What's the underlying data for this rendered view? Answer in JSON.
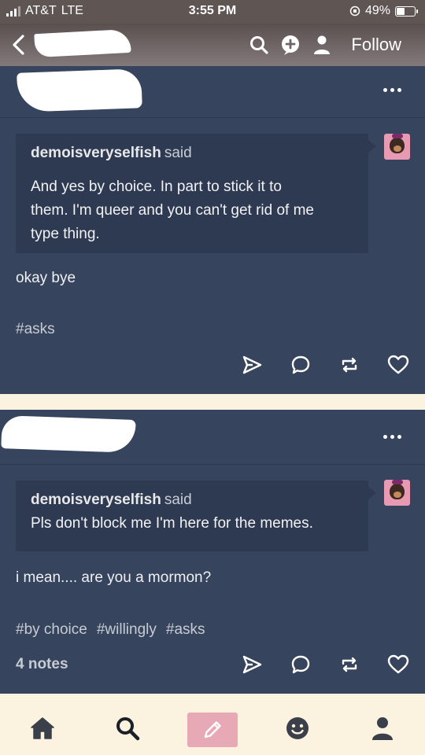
{
  "status_bar": {
    "carrier": "AT&T",
    "network": "LTE",
    "time": "3:55 PM",
    "battery": "49%",
    "battery_level": 0.49
  },
  "nav": {
    "follow_label": "Follow",
    "icons": [
      "back-chevron-icon",
      "search-icon",
      "add-circle-icon",
      "person-icon"
    ]
  },
  "posts": [
    {
      "quote_user": "demoisveryselfish",
      "quote_said": "said",
      "quote_lines": [
        "And yes by choice. In part to stick it to",
        "them. I'm queer and you can't get rid of me",
        "type thing."
      ],
      "reply": "okay bye",
      "tags": [
        "#asks"
      ]
    },
    {
      "quote_user": "demoisveryselfish",
      "quote_said": "said",
      "quote_lines": [
        "Pls don't block me I'm here for the memes."
      ],
      "reply": "i mean.... are you a mormon?",
      "tags": [
        "#by choice",
        "#willingly",
        "#asks"
      ],
      "notes": "4 notes"
    }
  ],
  "colors": {
    "post_bg": "#37445d",
    "quote_bg": "#2e3a51",
    "page_bg": "#fbf2e0",
    "accent_compose": "#e7a9b6",
    "tab_icon": "#3a3f4a"
  },
  "tab_bar": {
    "icons": [
      "home-icon",
      "search-icon",
      "compose-pencil-icon",
      "activity-smiley-icon",
      "account-person-icon"
    ]
  }
}
